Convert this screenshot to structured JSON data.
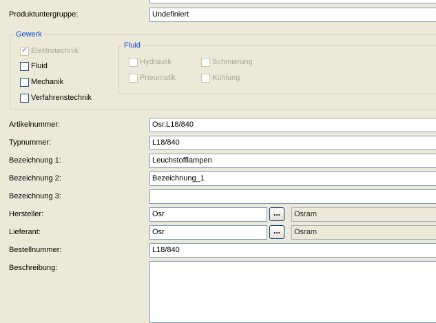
{
  "produktuntergruppe": {
    "label": "Produktuntergruppe:",
    "value": "Undefiniert"
  },
  "gewerk": {
    "title": "Gewerk",
    "elektrotechnik": "Elektrotechnik",
    "fluid": "Fluid",
    "mechanik": "Mechanik",
    "verfahrenstechnik": "Verfahrenstechnik"
  },
  "fluid_group": {
    "title": "Fluid",
    "hydraulik": "Hydraulik",
    "schmierung": "Schmierung",
    "pneumatik": "Pneumatik",
    "kuehlung": "Kühlung"
  },
  "artikelnummer": {
    "label": "Artikelnummer:",
    "value": "Osr.L18/840"
  },
  "typnummer": {
    "label": "Typnummer:",
    "value": "L18/840"
  },
  "bezeichnung1": {
    "label": "Bezeichnung 1:",
    "value": "Leuchstofflampen"
  },
  "bezeichnung2": {
    "label": "Bezeichnung 2:",
    "value": "Bezeichnung_1"
  },
  "bezeichnung3": {
    "label": "Bezeichnung 3:",
    "value": ""
  },
  "hersteller": {
    "label": "Hersteller:",
    "value": "Osr",
    "button": "...",
    "name": "Osram"
  },
  "lieferant": {
    "label": "Lieferant:",
    "value": "Osr",
    "button": "...",
    "name": "Osram"
  },
  "bestellnummer": {
    "label": "Bestellnummer:",
    "value": "L18/840"
  },
  "beschreibung": {
    "label": "Beschreibung:",
    "value": ""
  }
}
